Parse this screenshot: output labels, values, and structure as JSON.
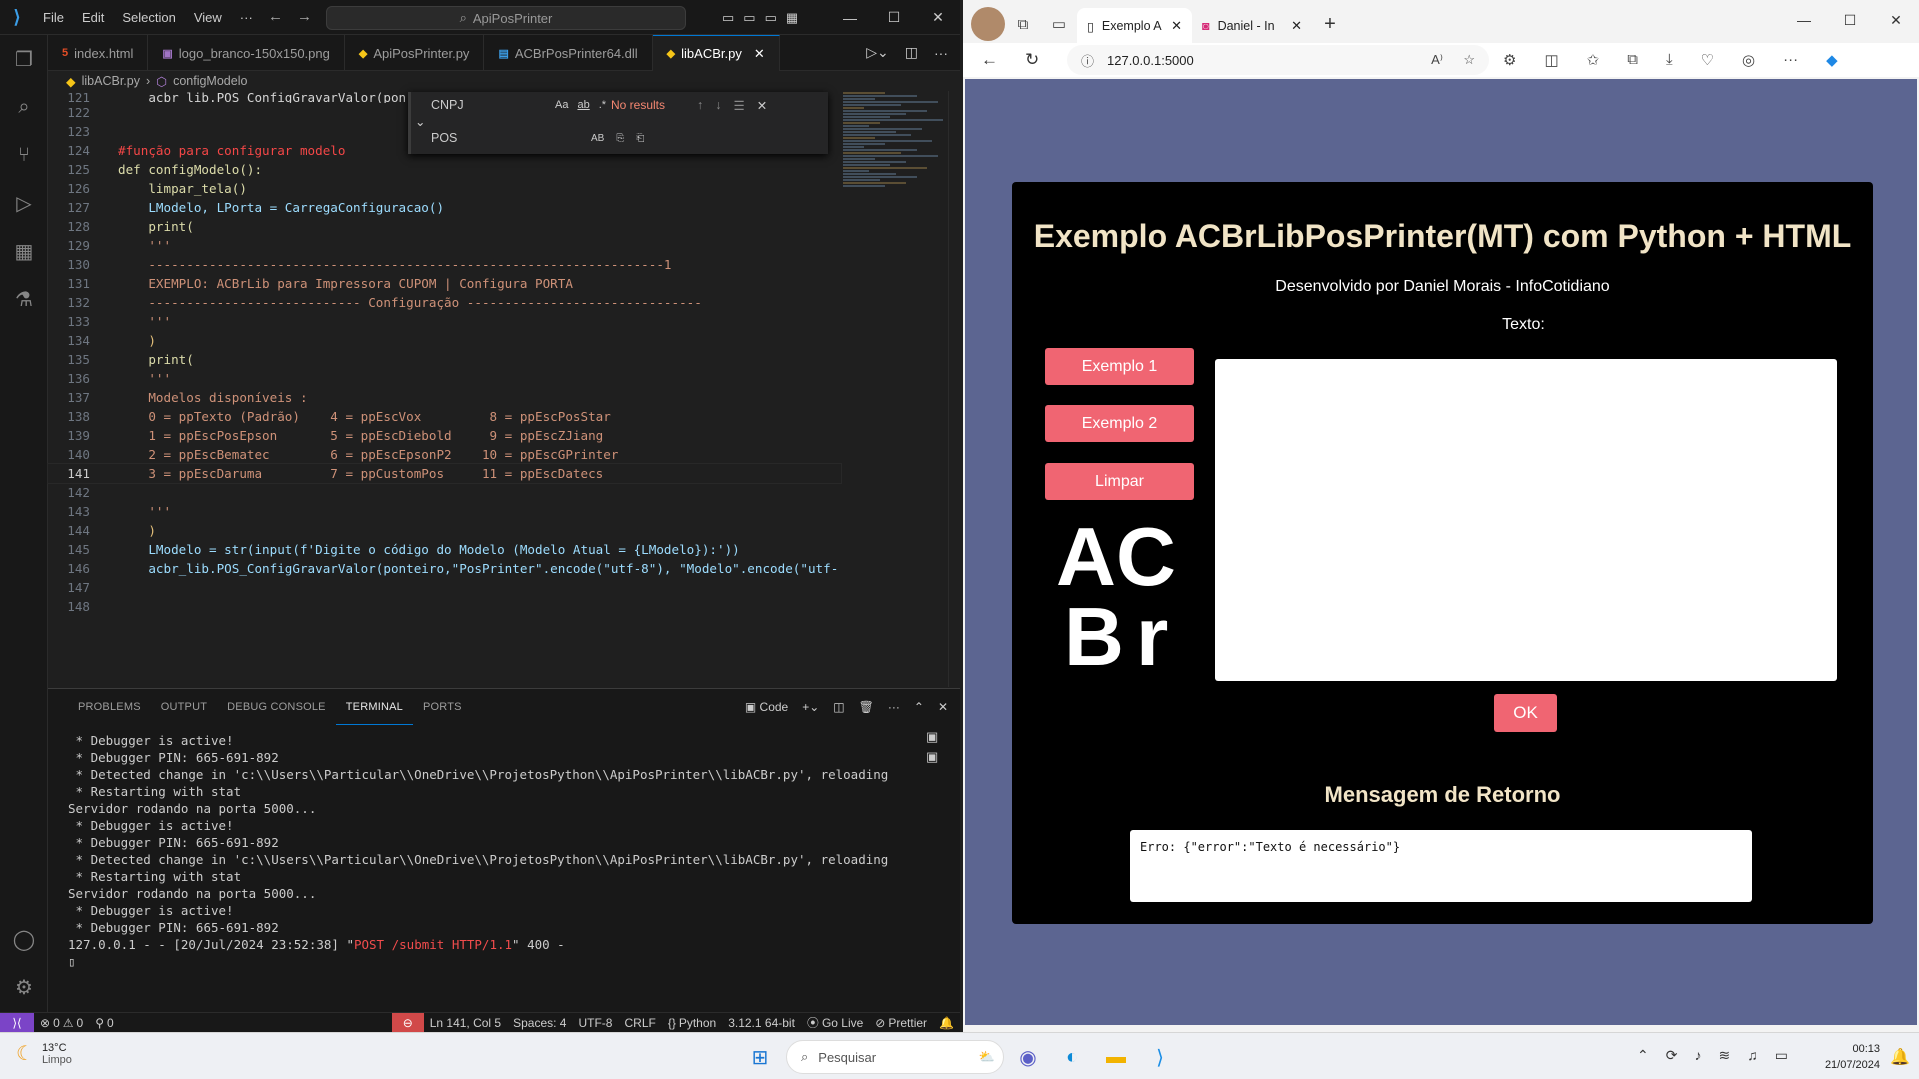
{
  "vscode": {
    "menu": [
      "File",
      "Edit",
      "Selection",
      "View",
      "···"
    ],
    "search": "ApiPosPrinter",
    "tabs": [
      {
        "label": "index.html",
        "icon": "html-icon",
        "color": "#e44d26"
      },
      {
        "label": "logo_branco-150x150.png",
        "icon": "image-icon",
        "color": "#a074c4"
      },
      {
        "label": "ApiPosPrinter.py",
        "icon": "python-icon",
        "color": "#f5c518"
      },
      {
        "label": "ACBrPosPrinter64.dll",
        "icon": "dll-icon",
        "color": "#3b9de6"
      },
      {
        "label": "libACBr.py",
        "icon": "python-icon",
        "color": "#f5c518"
      }
    ],
    "breadcrumb": [
      "libACBr.py",
      "configModelo"
    ],
    "find": {
      "term": "CNPJ",
      "replace": "POS",
      "result": "No results",
      "opt1": "Aa",
      "opt2": "ab",
      "opt3": ".*",
      "opt4": "AB"
    },
    "code_first_partial": "    acbr_lib.POS_ConfigGravarValor(pon",
    "code": [
      {
        "n": "122",
        "t": ""
      },
      {
        "n": "123",
        "t": ""
      },
      {
        "n": "124",
        "t": "#função para configurar modelo",
        "k": "cm"
      },
      {
        "n": "125",
        "t": "def configModelo():",
        "k": "def"
      },
      {
        "n": "126",
        "t": "    limpar_tela()",
        "k": "fn"
      },
      {
        "n": "127",
        "t": "    LModelo, LPorta = CarregaConfiguracao()",
        "k": "assign"
      },
      {
        "n": "128",
        "t": "    print(",
        "k": "fn"
      },
      {
        "n": "129",
        "t": "    '''",
        "k": "st"
      },
      {
        "n": "130",
        "t": "    --------------------------------------------------------------------1",
        "k": "st"
      },
      {
        "n": "131",
        "t": "    EXEMPLO: ACBrLib para Impressora CUPOM | Configura PORTA",
        "k": "st"
      },
      {
        "n": "132",
        "t": "    ---------------------------- Configuração -------------------------------",
        "k": "st"
      },
      {
        "n": "133",
        "t": "    '''",
        "k": "st"
      },
      {
        "n": "134",
        "t": "    )",
        "k": "pu"
      },
      {
        "n": "135",
        "t": "    print(",
        "k": "fn"
      },
      {
        "n": "136",
        "t": "    '''",
        "k": "st"
      },
      {
        "n": "137",
        "t": "    Modelos disponíveis :",
        "k": "st"
      },
      {
        "n": "138",
        "t": "    0 = ppTexto (Padrão)    4 = ppEscVox         8 = ppEscPosStar",
        "k": "st"
      },
      {
        "n": "139",
        "t": "    1 = ppEscPosEpson       5 = ppEscDiebold     9 = ppEscZJiang",
        "k": "st"
      },
      {
        "n": "140",
        "t": "    2 = ppEscBematec        6 = ppEscEpsonP2    10 = ppEscGPrinter",
        "k": "st"
      },
      {
        "n": "141",
        "t": "    3 = ppEscDaruma         7 = ppCustomPos     11 = ppEscDatecs",
        "k": "st",
        "cur": true
      },
      {
        "n": "142",
        "t": "",
        "k": "st"
      },
      {
        "n": "143",
        "t": "    '''",
        "k": "st"
      },
      {
        "n": "144",
        "t": "    )",
        "k": "pu"
      },
      {
        "n": "145",
        "t": "    LModelo = str(input(f'Digite o código do Modelo (Modelo Atual = {LModelo}):'))",
        "k": "mix"
      },
      {
        "n": "146",
        "t": "    acbr_lib.POS_ConfigGravarValor(ponteiro,\"PosPrinter\".encode(\"utf-8\"), \"Modelo\".encode(\"utf-",
        "k": "mix2"
      },
      {
        "n": "147",
        "t": ""
      },
      {
        "n": "148",
        "t": ""
      }
    ],
    "panel_tabs": [
      "PROBLEMS",
      "OUTPUT",
      "DEBUG CONSOLE",
      "TERMINAL",
      "PORTS"
    ],
    "panel_active": "TERMINAL",
    "terminal_profile": "Code",
    "terminal": [
      " * Debugger is active!",
      " * Debugger PIN: 665-691-892",
      " * Detected change in 'c:\\\\Users\\\\Particular\\\\OneDrive\\\\ProjetosPython\\\\ApiPosPrinter\\\\libACBr.py', reloading",
      " * Restarting with stat",
      "Servidor rodando na porta 5000...",
      " * Debugger is active!",
      " * Debugger PIN: 665-691-892",
      " * Detected change in 'c:\\\\Users\\\\Particular\\\\OneDrive\\\\ProjetosPython\\\\ApiPosPrinter\\\\libACBr.py', reloading",
      " * Restarting with stat",
      "Servidor rodando na porta 5000...",
      " * Debugger is active!",
      " * Debugger PIN: 665-691-892"
    ],
    "terminal_last_pre": "127.0.0.1 - - [20/Jul/2024 23:52:38] \"",
    "terminal_last_red": "POST /submit HTTP/1.1",
    "terminal_last_post": "\" 400 -",
    "status": {
      "errors": "0",
      "warnings": "0",
      "ports": "0",
      "position": "Ln 141, Col 5",
      "spaces": "Spaces: 4",
      "encoding": "UTF-8",
      "eol": "CRLF",
      "lang": "Python",
      "version": "3.12.1 64-bit",
      "golive": "Go Live",
      "prettier": "Prettier"
    }
  },
  "edge": {
    "tabs": [
      {
        "label": "Exemplo A",
        "close": "✕"
      },
      {
        "label": "Daniel - In",
        "close": "✕"
      }
    ],
    "url": "127.0.0.1:5000",
    "page": {
      "title": "Exemplo ACBrLibPosPrinter(MT) com Python + HTML",
      "subtitle": "Desenvolvido por Daniel Morais - InfoCotidiano",
      "texto_label": "Texto:",
      "btn1": "Exemplo 1",
      "btn2": "Exemplo 2",
      "btn3": "Limpar",
      "logo_line1": "AC",
      "logo_line2": "Br",
      "ok": "OK",
      "ret_title": "Mensagem de Retorno",
      "ret_text": "Erro: {\"error\":\"Texto é necessário\"}"
    }
  },
  "taskbar": {
    "temp": "13°C",
    "cond": "Limpo",
    "search": "Pesquisar",
    "time": "00:13",
    "date": "21/07/2024"
  }
}
